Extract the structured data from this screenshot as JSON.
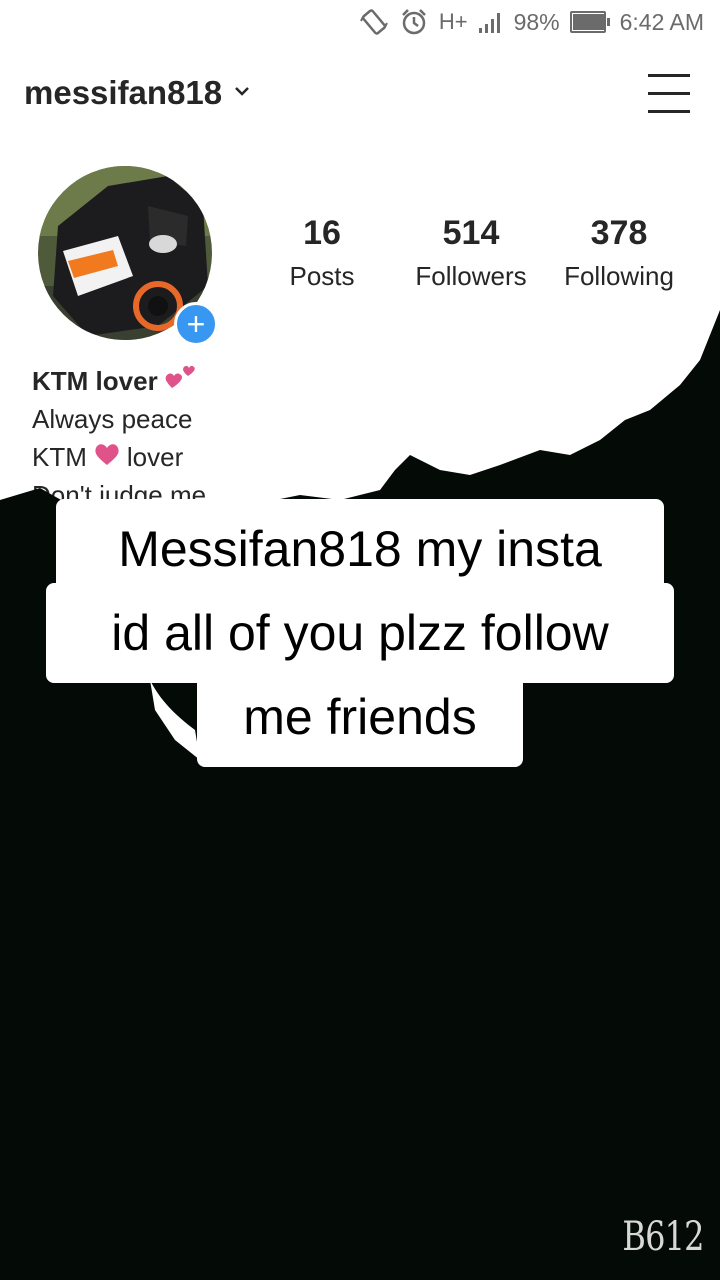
{
  "status_bar": {
    "network": "H+",
    "battery": "98%",
    "battery_level": 0.98,
    "time": "6:42 AM",
    "icons": [
      "vibrate-icon",
      "alarm-icon",
      "network-type-icon",
      "signal-icon",
      "battery-icon"
    ]
  },
  "profile": {
    "username": "messifan818",
    "stats": [
      {
        "value": "16",
        "label": "Posts"
      },
      {
        "value": "514",
        "label": "Followers"
      },
      {
        "value": "378",
        "label": "Following"
      }
    ],
    "bio": {
      "name": "KTM lover",
      "line1": "Always peace",
      "line2_a": "KTM",
      "line2_b": "lover",
      "line3": "Don't judge me"
    }
  },
  "caption": {
    "line1": "Messifan818  my insta",
    "line2": "id all of you plzz follow",
    "line3": "me friends"
  },
  "watermark": "B612",
  "colors": {
    "accent_blue": "#3897f0",
    "heart_pink": "#e0528a",
    "overlay_black": "#040a06"
  }
}
